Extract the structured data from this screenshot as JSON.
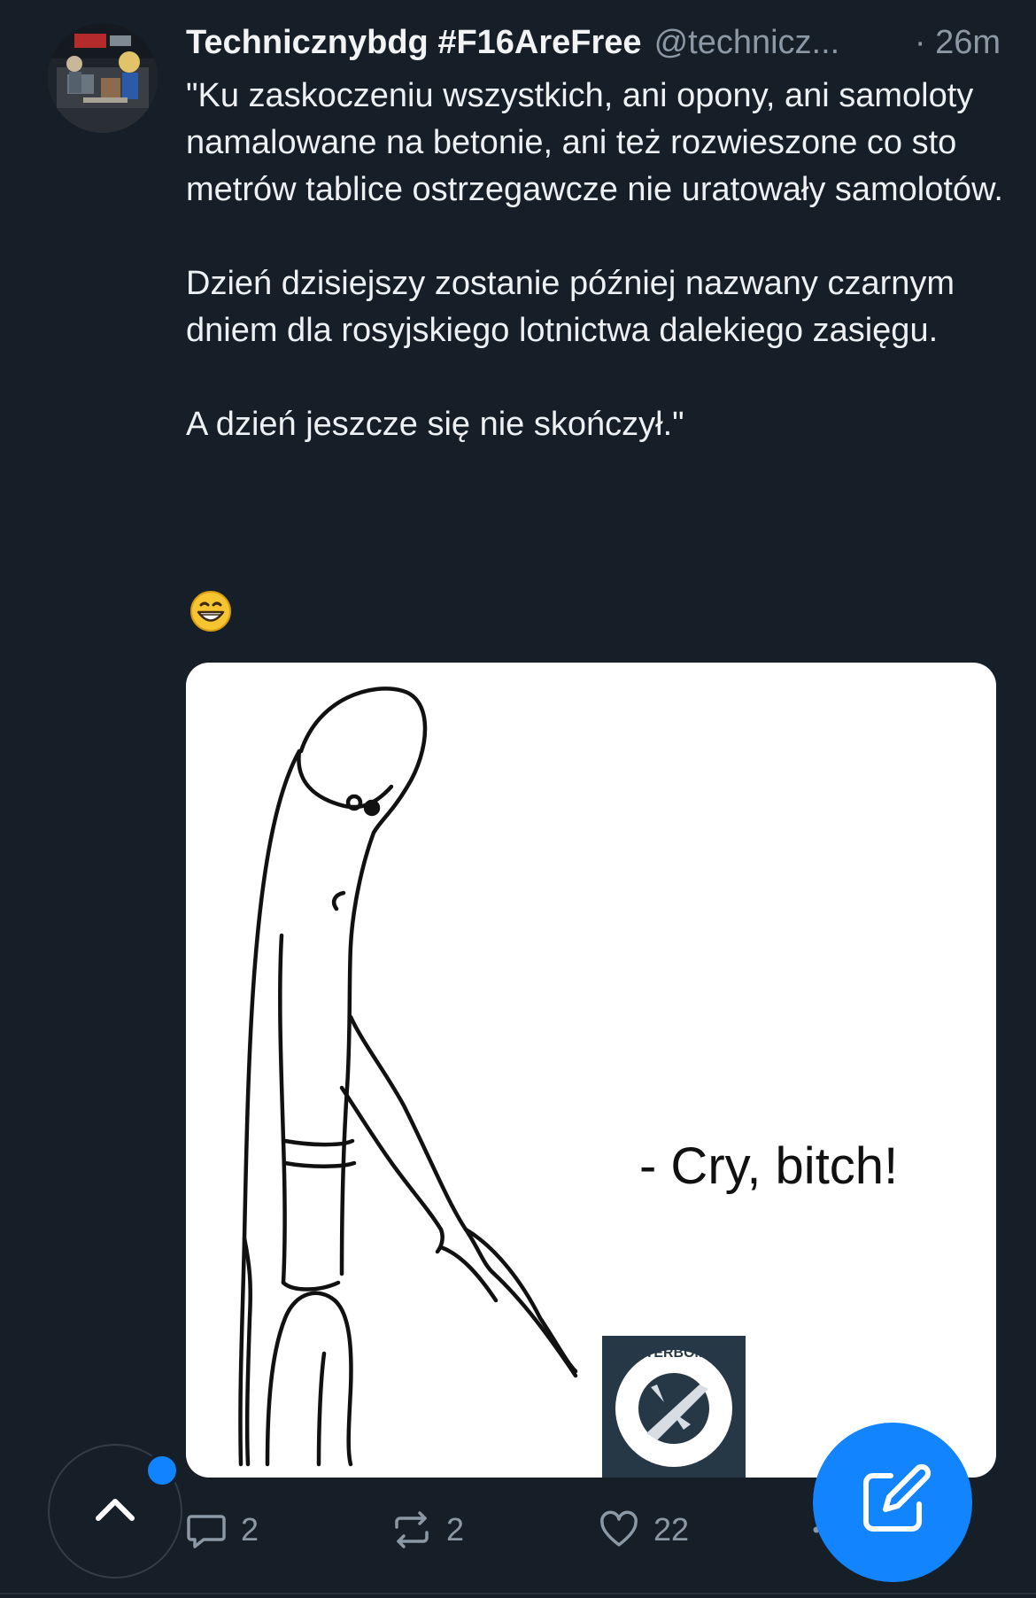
{
  "post": {
    "display_name": "Technicznybdg #F16AreFree",
    "handle": "@technicz...",
    "timestamp": "· 26m",
    "paragraphs": [
      "\"Ku zaskoczeniu wszystkich, ani opony, ani samoloty namalowane na betonie, ani też rozwieszone co sto metrów tablice ostrzegawcze nie uratowały samolotów.",
      "Dzień dzisiejszy zostanie później nazwany czarnym dniem dla rosyjskiego lotnictwa dalekiego zasięgu.",
      "A dzień jeszcze się nie skończył.\""
    ],
    "emoji_icon": "grinning-face-emoji",
    "image": {
      "caption": "- Cry, bitch!",
      "badge_text": "FIGHTERBOMBER"
    }
  },
  "actions": {
    "replies": "2",
    "reposts": "2",
    "likes": "22"
  },
  "icons": {
    "reply": "speech-bubble-icon",
    "repost": "repost-icon",
    "like": "heart-icon",
    "scroll_top": "chevron-up-icon",
    "compose": "compose-icon"
  },
  "colors": {
    "background": "#161e27",
    "accent": "#1184fe",
    "muted": "#8b98a5"
  }
}
